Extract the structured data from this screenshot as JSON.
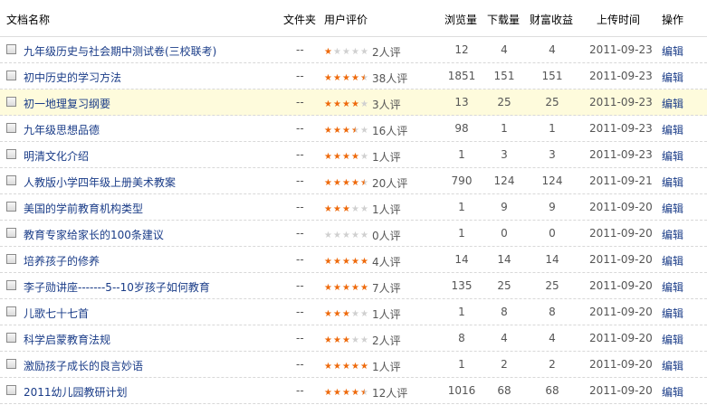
{
  "header": {
    "doc_name": "文档名称",
    "folder": "文件夹",
    "rating": "用户评价",
    "views": "浏览量",
    "downloads": "下载量",
    "income": "财富收益",
    "upload_time": "上传时间",
    "action": "操作"
  },
  "colors": {
    "link": "#1a3c88",
    "star": "#ee6a0c",
    "highlight_row": "#fefbdc"
  },
  "rows": [
    {
      "title": "九年级历史与社会期中测试卷(三校联考)",
      "folder": "--",
      "stars": 1,
      "rating_count": "2人评",
      "views": "12",
      "downloads": "4",
      "income": "4",
      "date": "2011-09-23",
      "action": "编辑"
    },
    {
      "title": "初中历史的学习方法",
      "folder": "--",
      "stars": 4.5,
      "rating_count": "38人评",
      "views": "1851",
      "downloads": "151",
      "income": "151",
      "date": "2011-09-23",
      "action": "编辑"
    },
    {
      "title": "初一地理复习纲要",
      "folder": "--",
      "stars": 4,
      "rating_count": "3人评",
      "views": "13",
      "downloads": "25",
      "income": "25",
      "date": "2011-09-23",
      "action": "编辑",
      "highlight": true
    },
    {
      "title": "九年级思想品德",
      "folder": "--",
      "stars": 3.5,
      "rating_count": "16人评",
      "views": "98",
      "downloads": "1",
      "income": "1",
      "date": "2011-09-23",
      "action": "编辑"
    },
    {
      "title": "明清文化介绍",
      "folder": "--",
      "stars": 4,
      "rating_count": "1人评",
      "views": "1",
      "downloads": "3",
      "income": "3",
      "date": "2011-09-23",
      "action": "编辑"
    },
    {
      "title": "人教版小学四年级上册美术教案",
      "folder": "--",
      "stars": 4.5,
      "rating_count": "20人评",
      "views": "790",
      "downloads": "124",
      "income": "124",
      "date": "2011-09-21",
      "action": "编辑"
    },
    {
      "title": "美国的学前教育机构类型",
      "folder": "--",
      "stars": 3,
      "rating_count": "1人评",
      "views": "1",
      "downloads": "9",
      "income": "9",
      "date": "2011-09-20",
      "action": "编辑"
    },
    {
      "title": "教育专家给家长的100条建议",
      "folder": "--",
      "stars": 0,
      "rating_count": "0人评",
      "views": "1",
      "downloads": "0",
      "income": "0",
      "date": "2011-09-20",
      "action": "编辑"
    },
    {
      "title": "培养孩子的修养",
      "folder": "--",
      "stars": 5,
      "rating_count": "4人评",
      "views": "14",
      "downloads": "14",
      "income": "14",
      "date": "2011-09-20",
      "action": "编辑"
    },
    {
      "title": "李子勋讲座-------5--10岁孩子如何教育",
      "folder": "--",
      "stars": 5,
      "rating_count": "7人评",
      "views": "135",
      "downloads": "25",
      "income": "25",
      "date": "2011-09-20",
      "action": "编辑"
    },
    {
      "title": "儿歌七十七首",
      "folder": "--",
      "stars": 3,
      "rating_count": "1人评",
      "views": "1",
      "downloads": "8",
      "income": "8",
      "date": "2011-09-20",
      "action": "编辑"
    },
    {
      "title": "科学启蒙教育法规",
      "folder": "--",
      "stars": 3,
      "rating_count": "2人评",
      "views": "8",
      "downloads": "4",
      "income": "4",
      "date": "2011-09-20",
      "action": "编辑"
    },
    {
      "title": "激励孩子成长的良言妙语",
      "folder": "--",
      "stars": 5,
      "rating_count": "1人评",
      "views": "1",
      "downloads": "2",
      "income": "2",
      "date": "2011-09-20",
      "action": "编辑"
    },
    {
      "title": "2011幼儿园教研计划",
      "folder": "--",
      "stars": 4.5,
      "rating_count": "12人评",
      "views": "1016",
      "downloads": "68",
      "income": "68",
      "date": "2011-09-20",
      "action": "编辑"
    }
  ]
}
